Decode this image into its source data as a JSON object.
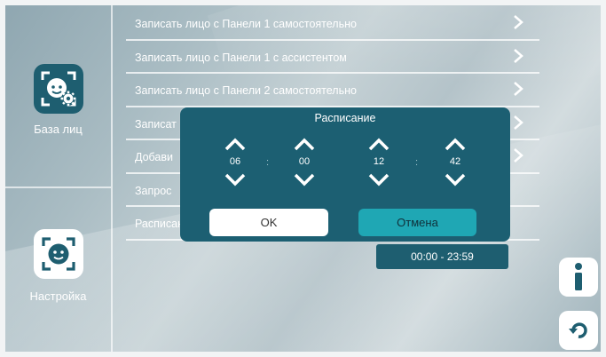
{
  "sidebar": {
    "items": [
      {
        "label": "База лиц",
        "icon": "face-settings-icon"
      },
      {
        "label": "Настройка",
        "icon": "face-scan-icon"
      }
    ]
  },
  "list": {
    "items": [
      {
        "label": "Записать лицо с Панели 1 самостоятельно"
      },
      {
        "label": "Записать лицо с Панели 1 с ассистентом"
      },
      {
        "label": "Записать лицо с Панели 2 самостоятельно"
      },
      {
        "label": "Записат"
      },
      {
        "label": "Добави"
      },
      {
        "label": "Запрос"
      },
      {
        "label": "Расписание",
        "value": "00:00 - 23:59"
      }
    ]
  },
  "dialog": {
    "title": "Расписание",
    "start_hour": "06",
    "start_minute": "00",
    "end_hour": "12",
    "end_minute": "42",
    "separator": ":",
    "ok_label": "OK",
    "cancel_label": "Отмена"
  },
  "colors": {
    "accent": "#1e5e70",
    "cancel": "#1fa7b4"
  }
}
